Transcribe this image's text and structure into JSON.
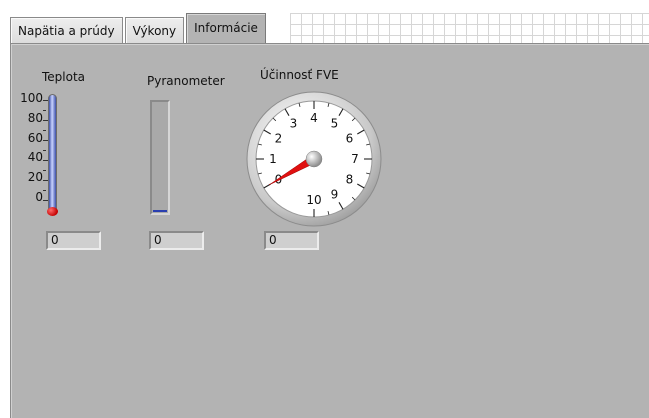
{
  "tabs": [
    {
      "label": "Napätia a prúdy",
      "active": false
    },
    {
      "label": "Výkony",
      "active": false
    },
    {
      "label": "Informácie",
      "active": true
    }
  ],
  "thermometer": {
    "label": "Teplota",
    "scale": [
      "100",
      "80",
      "60",
      "40",
      "20",
      "0"
    ],
    "value": 0,
    "display": "0",
    "fill_color": "#3b4fa8",
    "bulb_color": "#c40000"
  },
  "pyranometer": {
    "label": "Pyranometer",
    "value": 0,
    "display": "0",
    "fill_color": "#2a3fb0"
  },
  "gauge": {
    "label": "Účinnosť FVE",
    "scale": [
      "0",
      "1",
      "2",
      "3",
      "4",
      "5",
      "6",
      "7",
      "8",
      "9",
      "10"
    ],
    "value": 0,
    "display": "0",
    "needle_color": "#e01010"
  },
  "colors": {
    "panel": "#b3b3b3",
    "indicator_bg": "#cfcfcf"
  }
}
